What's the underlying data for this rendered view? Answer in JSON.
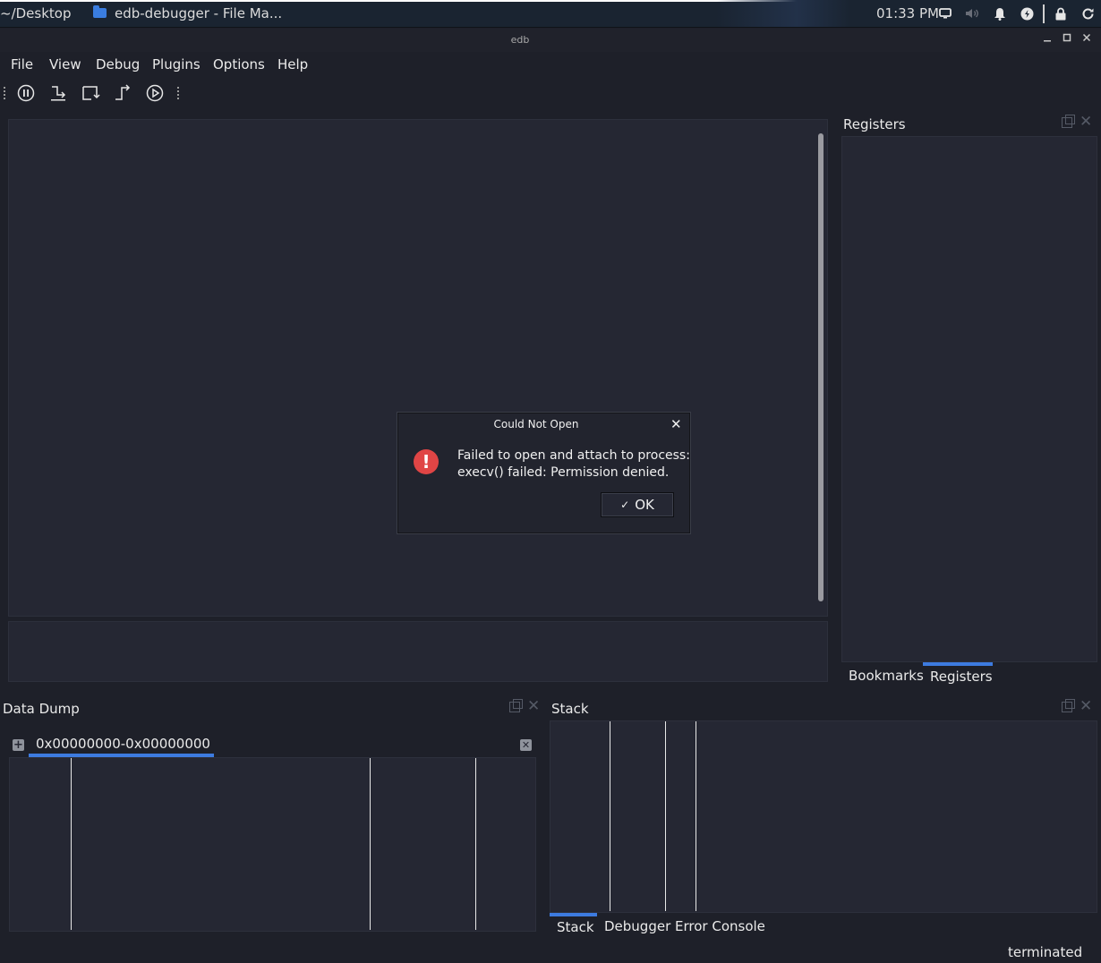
{
  "taskbar": {
    "path": "~/Desktop",
    "window_label": "edb-debugger - File Ma...",
    "clock": "01:33 PM",
    "icons": [
      "display-icon",
      "volume-icon",
      "bell-icon",
      "power-icon",
      "lock-icon",
      "refresh-icon"
    ]
  },
  "window": {
    "title": "edb"
  },
  "menu": {
    "file": "File",
    "view": "View",
    "debug": "Debug",
    "plugins": "Plugins",
    "options": "Options",
    "help": "Help"
  },
  "toolbar": {
    "buttons": [
      "pause-icon",
      "step-into-icon",
      "step-over-icon",
      "step-out-icon",
      "run-icon"
    ]
  },
  "docks": {
    "registers_title": "Registers",
    "right_tabs": [
      "Bookmarks",
      "Registers"
    ],
    "data_dump_title": "Data Dump",
    "data_dump_tab": "0x00000000-0x00000000",
    "stack_title": "Stack",
    "bottom_tabs": [
      "Stack",
      "Debugger Error Console"
    ]
  },
  "status": {
    "text": "terminated"
  },
  "dialog": {
    "title": "Could Not Open",
    "icon": "error-icon",
    "message_line1": "Failed to open and attach to process:",
    "message_line2": "execv() failed: Permission denied.",
    "ok_label": "OK"
  },
  "colors": {
    "background": "#1e2029",
    "panel": "#252733",
    "accent": "#3d7be0",
    "error": "#e04545"
  }
}
